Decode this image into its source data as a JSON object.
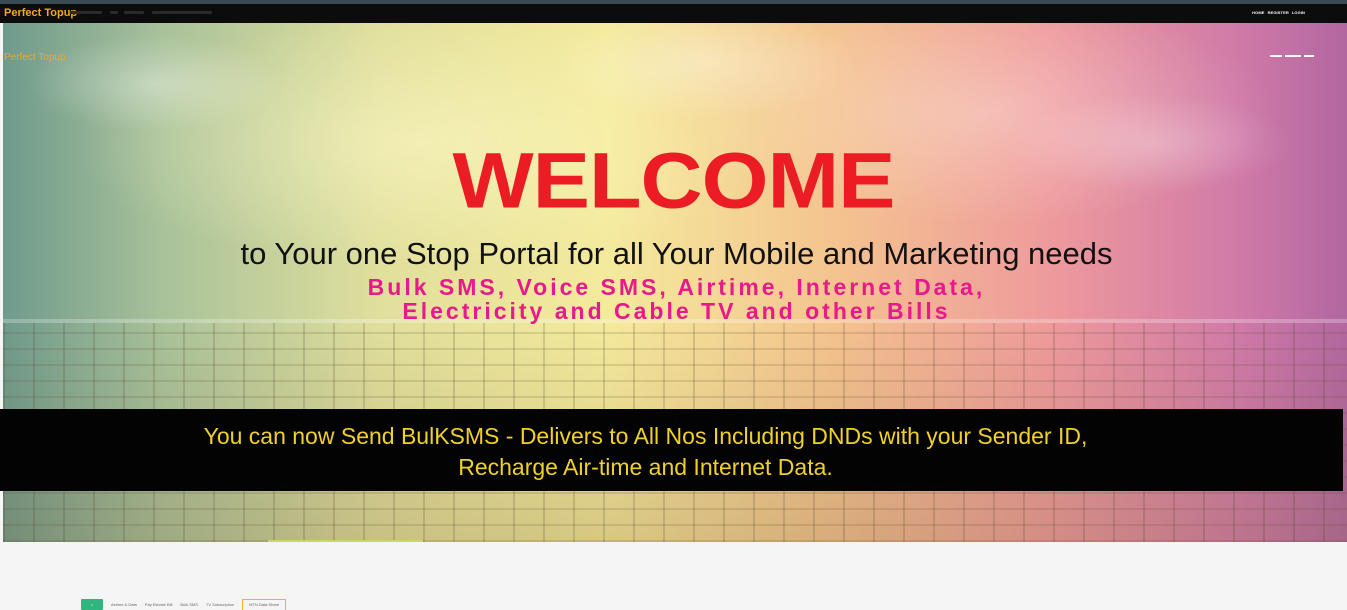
{
  "header": {
    "brand": "Perfect Topup",
    "nav": [
      "HOME",
      "REGISTER",
      "LOGIN"
    ]
  },
  "hero": {
    "brand": "Perfect Topup",
    "welcome": "WELCOME",
    "tagline": "to Your one Stop Portal for all Your Mobile and Marketing needs",
    "services_line1": "Bulk SMS, Voice SMS, Airtime, Internet Data,",
    "services_line2": "Electricity and Cable TV  and other Bills",
    "promo_line1": "You can now Send BulKSMS - Delivers to All Nos Including DNDs with your Sender ID,",
    "promo_line2": "Recharge Air-time and Internet Data."
  },
  "tabs": {
    "items": [
      "Airtime & Data",
      "Pay Electric Bill",
      "Bulk SMS",
      "TV Subscription",
      "MTN Data Share"
    ]
  },
  "colors": {
    "brand": "#f6a623",
    "welcome": "#ec1c24",
    "services": "#e8198b",
    "promo_text": "#f0d12a",
    "tab_accent": "#2fb57e",
    "active_tab_border": "#f0b429"
  }
}
